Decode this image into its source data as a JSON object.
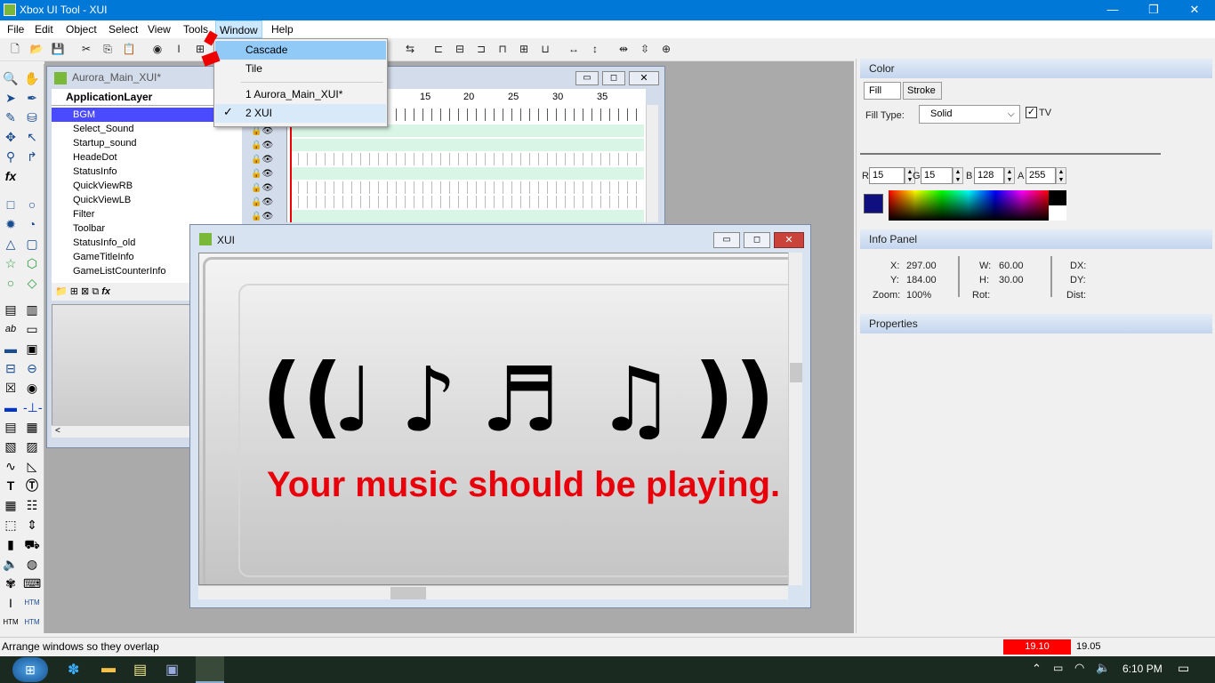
{
  "window": {
    "title": "Xbox UI Tool - XUI",
    "minimize": "—",
    "restore": "❐",
    "close": "✕"
  },
  "menu": [
    "File",
    "Edit",
    "Object",
    "View",
    "Tools",
    "Window",
    "Help"
  ],
  "window_menu": {
    "items": [
      {
        "label": "Cascade",
        "highlighted": true
      },
      {
        "label": "Tile",
        "highlighted": false
      },
      {
        "label": "1 Aurora_Main_XUI*",
        "checked": false
      },
      {
        "label": "2 XUI",
        "checked": true
      }
    ],
    "check_glyph": "✓"
  },
  "aurora_window": {
    "title": "Aurora_Main_XUI*",
    "layer_header": "ApplicationLayer",
    "timeline_ticks": [
      "15",
      "20",
      "25",
      "30",
      "35"
    ],
    "layers": [
      "BGM",
      "Select_Sound",
      "Startup_sound",
      "HeadeDot",
      "StatusInfo",
      "QuickViewRB",
      "QuickViewLB",
      "Filter",
      "Toolbar",
      "StatusInfo_old",
      "GameTitleInfo",
      "GameListCounterInfo"
    ],
    "selected_layer": "BGM",
    "fx_label": "fx"
  },
  "xui_window": {
    "title": "XUI",
    "notes": [
      "((",
      "♩",
      "♪",
      "♬",
      "♫",
      "))"
    ],
    "message": "Your music should be playing.",
    "message_color": "#e8000b"
  },
  "color_panel": {
    "title": "Color",
    "tabs": [
      "Fill",
      "Stroke"
    ],
    "fill_type_label": "Fill Type:",
    "fill_type_value": "Solid",
    "tv_label": "TV",
    "tv_checked": true,
    "channels": [
      {
        "label": "R",
        "value": "15"
      },
      {
        "label": "G",
        "value": "15"
      },
      {
        "label": "B",
        "value": "128"
      },
      {
        "label": "A",
        "value": "255"
      }
    ],
    "swatch_color": "#0f0f80"
  },
  "info_panel": {
    "title": "Info Panel",
    "x_label": "X:",
    "x_value": "297.00",
    "y_label": "Y:",
    "y_value": "184.00",
    "zoom_label": "Zoom:",
    "zoom_value": "100%",
    "w_label": "W:",
    "w_value": "60.00",
    "h_label": "H:",
    "h_value": "30.00",
    "rot_label": "Rot:",
    "dx_label": "DX:",
    "dy_label": "DY:",
    "dist_label": "Dist:"
  },
  "properties_panel": {
    "title": "Properties"
  },
  "status": {
    "text": "Arrange windows so they overlap",
    "value_red": "19.10",
    "value2": "19.05"
  },
  "taskbar": {
    "time": "6:10 PM"
  }
}
